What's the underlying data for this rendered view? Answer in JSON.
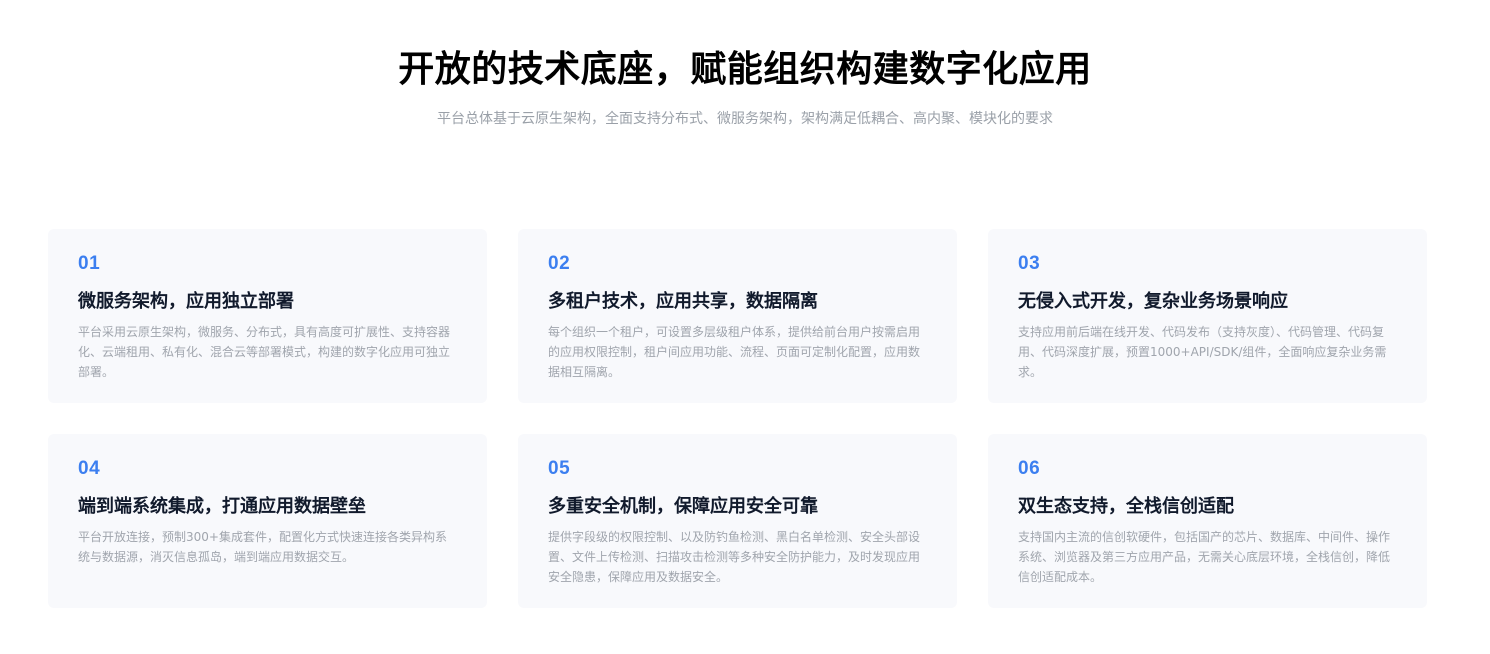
{
  "header": {
    "title": "开放的技术底座，赋能组织构建数字化应用",
    "subtitle": "平台总体基于云原生架构，全面支持分布式、微服务架构，架构满足低耦合、高内聚、模块化的要求"
  },
  "colors": {
    "accent": "#3c7ff0",
    "card_background": "#f8f9fc",
    "title_text": "#111a2c",
    "muted_text": "#a0a5ad"
  },
  "cards": [
    {
      "number": "01",
      "title": "微服务架构，应用独立部署",
      "description": "平台采用云原生架构，微服务、分布式，具有高度可扩展性、支持容器化、云端租用、私有化、混合云等部署模式，构建的数字化应用可独立部署。"
    },
    {
      "number": "02",
      "title": "多租户技术，应用共享，数据隔离",
      "description": "每个组织一个租户，可设置多层级租户体系，提供给前台用户按需启用的应用权限控制，租户间应用功能、流程、页面可定制化配置，应用数据相互隔离。"
    },
    {
      "number": "03",
      "title": "无侵入式开发，复杂业务场景响应",
      "description": "支持应用前后端在线开发、代码发布（支持灰度）、代码管理、代码复用、代码深度扩展，预置1000+API/SDK/组件，全面响应复杂业务需求。"
    },
    {
      "number": "04",
      "title": "端到端系统集成，打通应用数据壁垒",
      "description": "平台开放连接，预制300+集成套件，配置化方式快速连接各类异构系统与数据源，消灭信息孤岛，端到端应用数据交互。"
    },
    {
      "number": "05",
      "title": "多重安全机制，保障应用安全可靠",
      "description": "提供字段级的权限控制、以及防钓鱼检测、黑白名单检测、安全头部设置、文件上传检测、扫描攻击检测等多种安全防护能力，及时发现应用安全隐患，保障应用及数据安全。"
    },
    {
      "number": "06",
      "title": "双生态支持，全栈信创适配",
      "description": "支持国内主流的信创软硬件，包括国产的芯片、数据库、中间件、操作系统、浏览器及第三方应用产品，无需关心底层环境，全栈信创，降低信创适配成本。"
    }
  ]
}
